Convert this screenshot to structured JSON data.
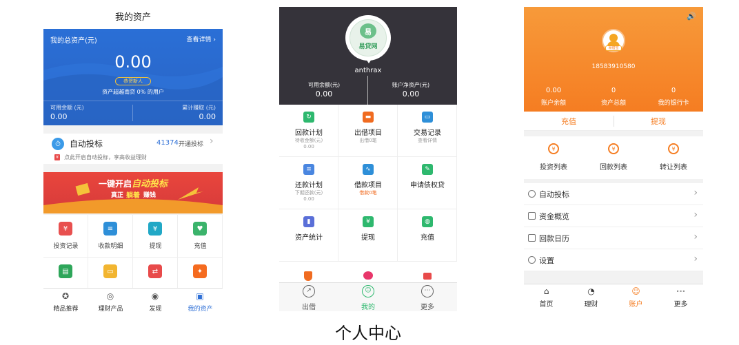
{
  "screen1": {
    "title": "我的资产",
    "hero": {
      "total_label": "我的总资产(元)",
      "details_link": "查看详情 ›",
      "total_value": "0.00",
      "badge": "恭贺新人",
      "note": "资产超越南贷 0% 的用户",
      "available_label": "可用余额 (元)",
      "available_value": "0.00",
      "earnings_label": "累计赚取 (元)",
      "earnings_value": "0.00"
    },
    "autobid": {
      "title": "自动投标",
      "count": "41374",
      "action": "开通投标",
      "chevron": "›",
      "desc": "点此开启自动投标，享高收益理财"
    },
    "banner": {
      "text_a": "一键开启",
      "text_b": "自动投标",
      "sub_a": "真正",
      "sub_b": "躺着",
      "sub_c": "赚钱"
    },
    "grid": [
      {
        "label": "投资记录",
        "color": "#e8504f"
      },
      {
        "label": "收款明细",
        "color": "#2e8fd8"
      },
      {
        "label": "提现",
        "color": "#21a8c6"
      },
      {
        "label": "充值",
        "color": "#3bb36b"
      },
      {
        "label": "",
        "color": "#2ea65a"
      },
      {
        "label": "",
        "color": "#f2b530"
      },
      {
        "label": "",
        "color": "#e84a4a"
      },
      {
        "label": "",
        "color": "#f56b1f"
      }
    ],
    "tabs": [
      {
        "label": "精品推荐"
      },
      {
        "label": "理财产品"
      },
      {
        "label": "发现"
      },
      {
        "label": "我的资产"
      }
    ],
    "active_tab_color": "#2e6fd6"
  },
  "screen2": {
    "logo_text": "易贷网",
    "username": "anthrax",
    "available_label": "可用余额(元)",
    "available_value": "0.00",
    "net_label": "账户净资产(元)",
    "net_value": "0.00",
    "grid": [
      {
        "label": "回款计划",
        "sub": "待收金额(元)",
        "sub2": "0.00",
        "color": "#2eb86e"
      },
      {
        "label": "出借项目",
        "sub": "出借0笔",
        "sub2": "",
        "color": "#f06b20"
      },
      {
        "label": "交易记录",
        "sub": "查看详情",
        "sub2": "",
        "color": "#2e8fd8"
      },
      {
        "label": "还款计划",
        "sub": "下期还款(元)",
        "sub2": "0.00",
        "color": "#4a86e0"
      },
      {
        "label": "借款项目",
        "sub": "借款0笔",
        "sub2": "",
        "color": "#2e8fd8",
        "sub_color": "#f06b20"
      },
      {
        "label": "申请债权贷",
        "sub": "",
        "sub2": "",
        "color": "#2eb86e"
      },
      {
        "label": "资产统计",
        "sub": "",
        "sub2": "",
        "color": "#5a6fd8"
      },
      {
        "label": "提现",
        "sub": "",
        "sub2": "",
        "color": "#2eb86e"
      },
      {
        "label": "充值",
        "sub": "",
        "sub2": "",
        "color": "#2eb86e"
      }
    ],
    "tabs": [
      {
        "label": "出借"
      },
      {
        "label": "我的"
      },
      {
        "label": "更多"
      }
    ],
    "active_tab_color": "#2eb86e"
  },
  "caption": "个人中心",
  "screen3": {
    "avatar_badge": "易借宝",
    "phone": "18583910580",
    "stats": [
      {
        "value": "0.00",
        "label": "账户余额"
      },
      {
        "value": "0",
        "label": "资产总额"
      },
      {
        "value": "0",
        "label": "我的银行卡"
      }
    ],
    "recharge": "充值",
    "withdraw": "提现",
    "lists": [
      {
        "label": "投资列表"
      },
      {
        "label": "回款列表"
      },
      {
        "label": "转让列表"
      }
    ],
    "rows": [
      {
        "label": "自动投标"
      },
      {
        "label": "资金概览"
      },
      {
        "label": "回款日历"
      },
      {
        "label": "设置"
      }
    ],
    "tabs": [
      {
        "label": "首页"
      },
      {
        "label": "理财"
      },
      {
        "label": "账户"
      },
      {
        "label": "更多"
      }
    ],
    "accent": "#f57d22"
  }
}
